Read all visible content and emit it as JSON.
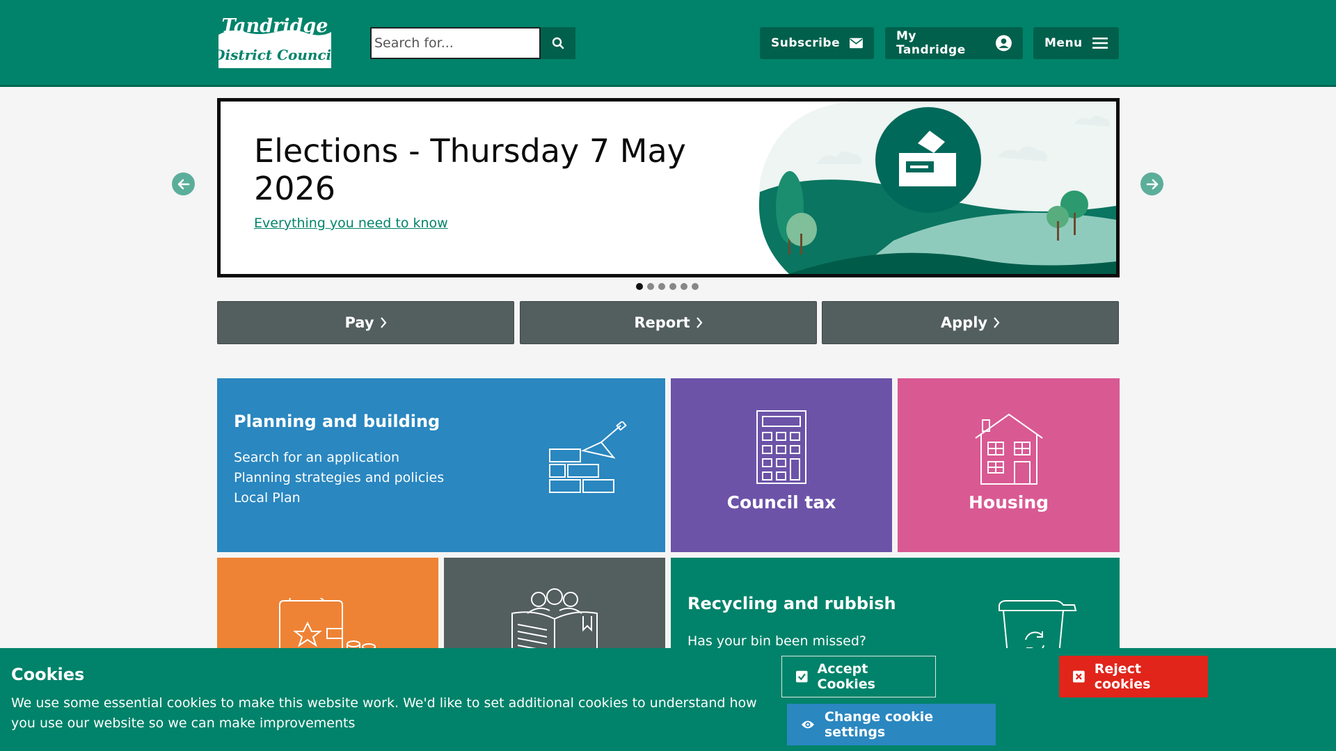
{
  "header": {
    "logo_line1": "Tandridge",
    "logo_line2": "District Council",
    "search_placeholder": "Search for...",
    "subscribe_label": "Subscribe",
    "my_account_label": "My Tandridge",
    "menu_label": "Menu"
  },
  "banner": {
    "title": "Elections - Thursday 7 May 2026",
    "link": "Everything you need to know",
    "slide_count": 6,
    "active_slide": 1
  },
  "actions": {
    "pay": "Pay",
    "report": "Report",
    "apply": "Apply"
  },
  "tiles": {
    "planning": {
      "title": "Planning and building",
      "links": [
        "Search for an application",
        "Planning strategies and policies",
        "Local Plan"
      ]
    },
    "council_tax": {
      "title": "Council tax"
    },
    "housing": {
      "title": "Housing"
    },
    "recycling": {
      "title": "Recycling and rubbish",
      "links": [
        "Has your bin been missed?"
      ]
    }
  },
  "cookies": {
    "title": "Cookies",
    "text": "We use some essential cookies to make this website work. We'd like to set additional cookies to understand how you use our website so we can make improvements",
    "accept": "Accept Cookies",
    "change": "Change cookie settings",
    "reject": "Reject cookies"
  },
  "colors": {
    "brand_green": "#00836a",
    "dark_green": "#00604c",
    "planning_blue": "#2a87c0",
    "council_purple": "#6c53a8",
    "housing_pink": "#d95993",
    "orange": "#ee8336",
    "slate": "#535e5e",
    "reject_red": "#e1251b"
  }
}
